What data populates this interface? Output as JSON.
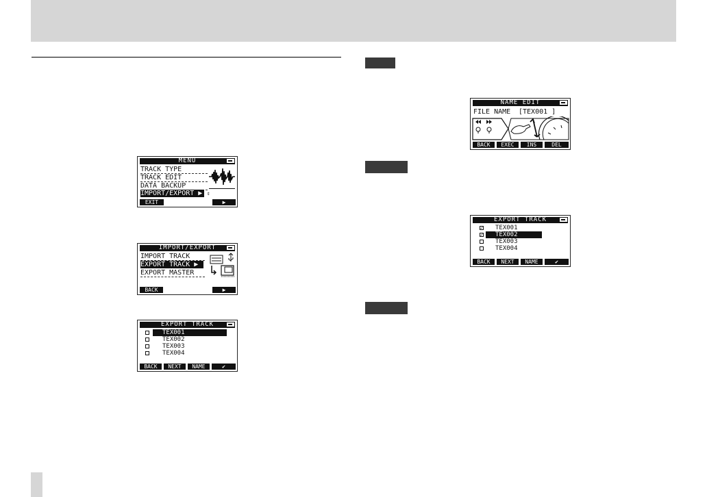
{
  "menu": {
    "title": "MENU",
    "items": [
      "TRACK TYPE",
      "TRACK EDIT",
      "DATA BACKUP",
      "IMPORT/EXPORT ▶"
    ],
    "buttons": [
      "EXIT",
      "▶"
    ]
  },
  "import_export": {
    "title": "IMPORT/EXPORT",
    "items": [
      "IMPORT TRACK",
      "EXPORT TRACK ▶",
      "EXPORT MASTER"
    ],
    "buttons": [
      "BACK",
      "▶"
    ]
  },
  "export_track_1": {
    "title": "EXPORT TRACK",
    "tracks": [
      "TEX001",
      "TEX002",
      "TEX003",
      "TEX004"
    ],
    "checks": [
      "",
      "",
      "",
      ""
    ],
    "buttons": [
      "BACK",
      "NEXT",
      "NAME",
      "✔"
    ]
  },
  "name_edit": {
    "title": "NAME EDIT",
    "label": "FILE NAME",
    "value": "[TEX001    ]",
    "buttons": [
      "BACK",
      "EXEC",
      "INS",
      "DEL"
    ]
  },
  "export_track_2": {
    "title": "EXPORT TRACK",
    "tracks": [
      "TEX001",
      "TEX002",
      "TEX003",
      "TEX004"
    ],
    "checks": [
      "☑",
      "☑",
      "",
      ""
    ],
    "buttons": [
      "BACK",
      "NEXT",
      "NAME",
      "✔"
    ]
  }
}
